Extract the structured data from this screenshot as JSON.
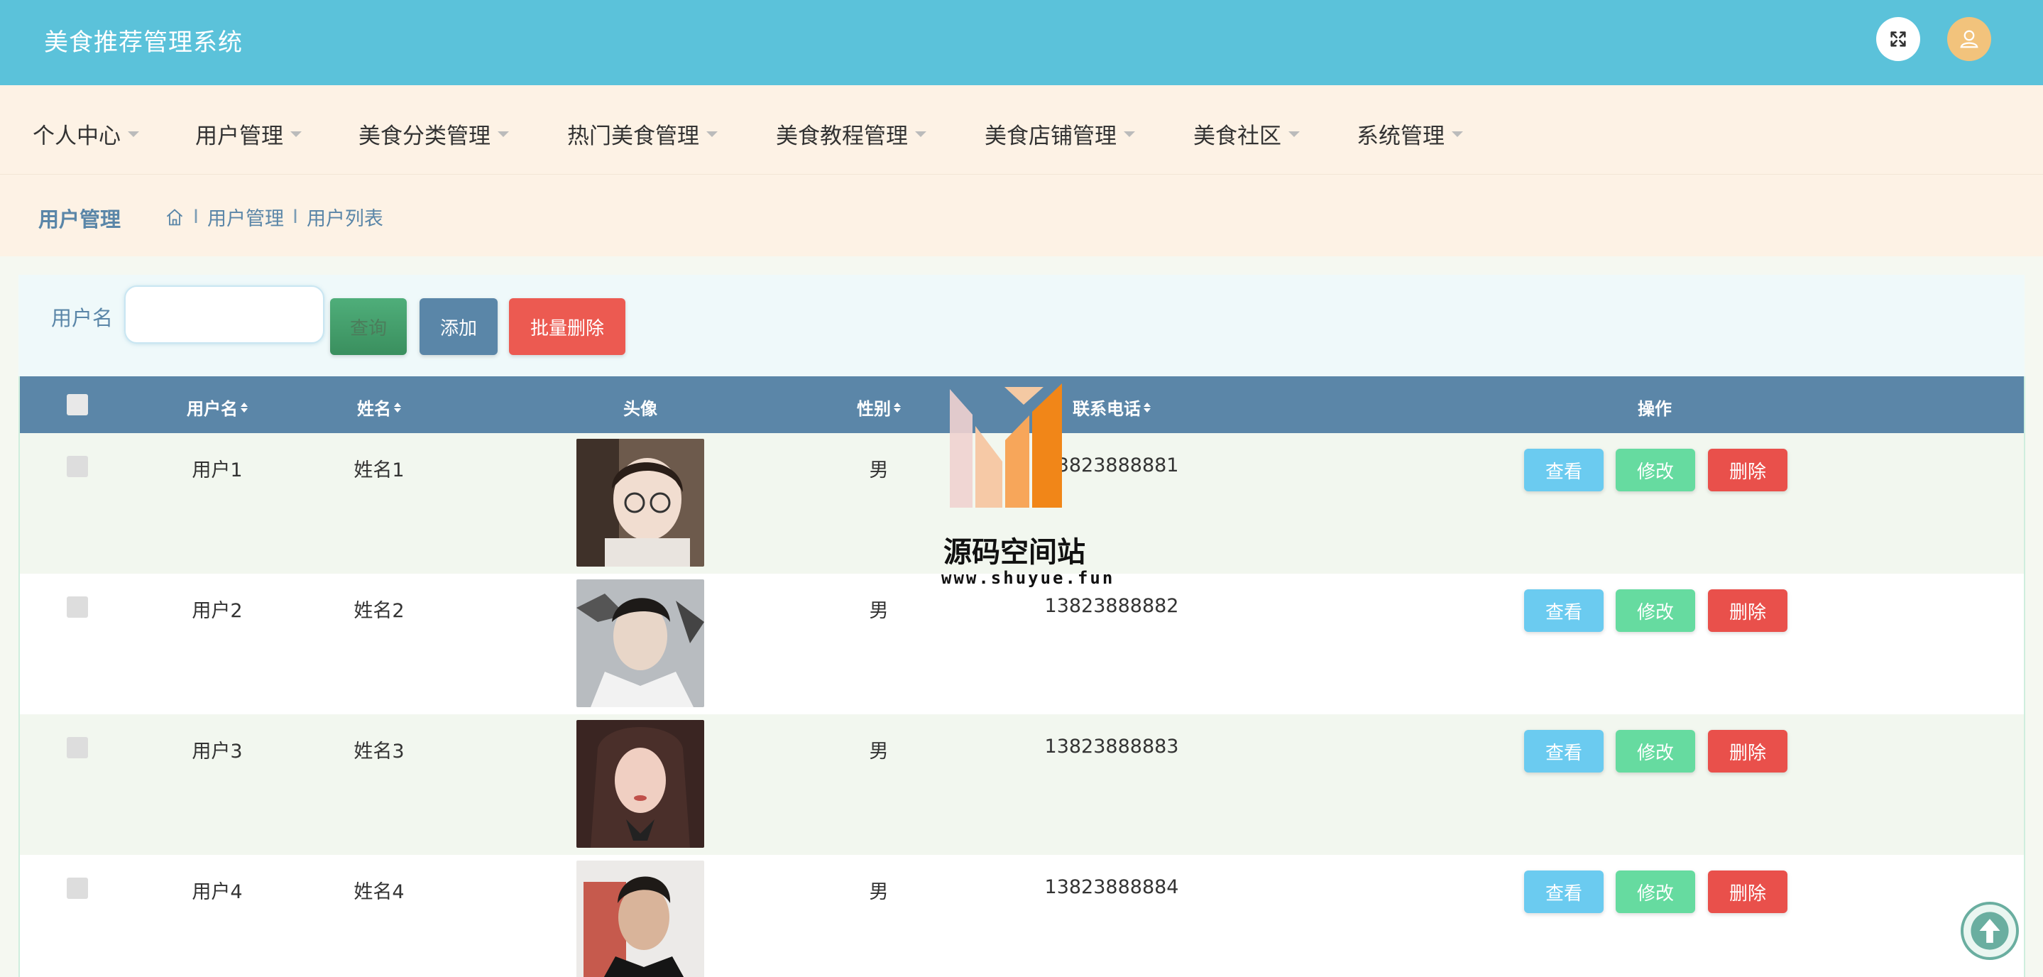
{
  "header": {
    "title": "美食推荐管理系统",
    "icons": [
      "fullscreen-icon",
      "user-avatar-icon"
    ]
  },
  "nav": {
    "items": [
      {
        "label": "个人中心"
      },
      {
        "label": "用户管理"
      },
      {
        "label": "美食分类管理"
      },
      {
        "label": "热门美食管理"
      },
      {
        "label": "美食教程管理"
      },
      {
        "label": "美食店铺管理"
      },
      {
        "label": "美食社区"
      },
      {
        "label": "系统管理"
      }
    ]
  },
  "breadcrumb": {
    "title": "用户管理",
    "path": [
      "用户管理",
      "用户列表"
    ],
    "separator": "I"
  },
  "search": {
    "label": "用户名",
    "value": "",
    "query_label": "查询",
    "add_label": "添加",
    "batch_delete_label": "批量删除"
  },
  "table": {
    "headers": {
      "username": "用户名",
      "name": "姓名",
      "avatar": "头像",
      "gender": "性别",
      "phone": "联系电话",
      "actions": "操作"
    },
    "rows": [
      {
        "username": "用户1",
        "name": "姓名1",
        "gender": "男",
        "phone": "13823888881"
      },
      {
        "username": "用户2",
        "name": "姓名2",
        "gender": "男",
        "phone": "13823888882"
      },
      {
        "username": "用户3",
        "name": "姓名3",
        "gender": "男",
        "phone": "13823888883"
      },
      {
        "username": "用户4",
        "name": "姓名4",
        "gender": "男",
        "phone": "13823888884"
      }
    ],
    "action_labels": {
      "view": "查看",
      "edit": "修改",
      "delete": "删除"
    }
  },
  "watermark": {
    "text": "源码空间站",
    "url": "www.shuyue.fun"
  },
  "colors": {
    "header": "#5bc2da",
    "nav_bg": "#fdf2e5",
    "table_head": "#5b86a8",
    "view": "#6bcbf0",
    "edit": "#66dba0",
    "delete": "#e9504b"
  }
}
